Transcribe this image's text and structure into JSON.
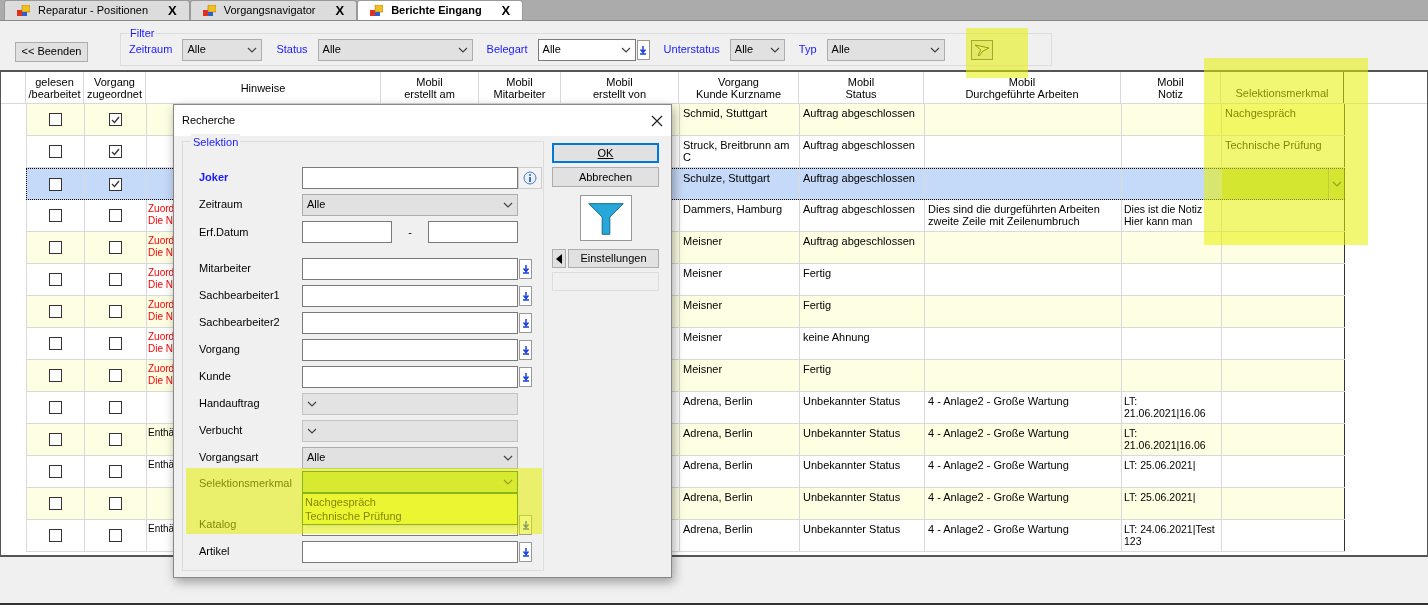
{
  "tabs": [
    {
      "label": "Reparatur - Positionen",
      "selected": false,
      "close": "X"
    },
    {
      "label": "Vorgangsnavigator",
      "selected": false,
      "close": "X"
    },
    {
      "label": "Berichte Eingang",
      "selected": true,
      "close": "X"
    }
  ],
  "toolbar": {
    "exit_button": "<< Beenden",
    "filter": {
      "legend": "Filter",
      "fields": [
        {
          "label": "Zeitraum",
          "value": "Alle",
          "kind": "select"
        },
        {
          "label": "Status",
          "value": "Alle",
          "kind": "select"
        },
        {
          "label": "Belegart",
          "value": "Alle",
          "kind": "combo"
        },
        {
          "label": "Unterstatus",
          "value": "Alle",
          "kind": "select"
        },
        {
          "label": "Typ",
          "value": "Alle",
          "kind": "select"
        }
      ]
    }
  },
  "table": {
    "columns": [
      "",
      "gelesen\n/bearbeitet",
      "Vorgang\nzugeordnet",
      "Hinweise",
      "Mobil\nerstellt am",
      "Mobil\nMitarbeiter",
      "Mobil\nerstellt von",
      "Vorgang\nKunde Kurzname",
      "Mobil\nStatus",
      "Mobil\nDurchgeführte Arbeiten",
      "Mobil\nNotiz",
      "Selektionsmerkmal"
    ],
    "rows": [
      {
        "selected": false,
        "read": false,
        "assigned": true,
        "hinweise": "",
        "kunde": "Schmid, Stuttgart",
        "status": "Auftrag abgeschlossen",
        "arbeiten": "",
        "notiz": "",
        "merkmal": "Nachgespräch"
      },
      {
        "selected": false,
        "read": false,
        "assigned": true,
        "hinweise": "",
        "kunde": "Struck, Breitbrunn am C",
        "status": "Auftrag abgeschlossen",
        "arbeiten": "",
        "notiz": "",
        "merkmal": "Technische Prüfung"
      },
      {
        "selected": true,
        "read": false,
        "assigned": true,
        "hinweise": "",
        "kunde": "Schulze, Stuttgart",
        "status": "Auftrag abgeschlossen",
        "arbeiten": "",
        "notiz": "",
        "merkmal": ""
      },
      {
        "selected": false,
        "read": false,
        "assigned": false,
        "hinweise": "Zuord\nDie N",
        "kunde": "Dammers, Hamburg",
        "status": "Auftrag abgeschlossen",
        "arbeiten": "Dies sind die durgeführten Arbeiten\nzweite Zeile mit Zeilenumbruch",
        "notiz": "Dies ist die Notiz\nHier kann man",
        "merkmal": ""
      },
      {
        "selected": false,
        "read": false,
        "assigned": false,
        "hinweise": "Zuord\nDie N",
        "kunde": "Meisner",
        "status": "Auftrag abgeschlossen",
        "arbeiten": "",
        "notiz": "",
        "merkmal": ""
      },
      {
        "selected": false,
        "read": false,
        "assigned": false,
        "hinweise": "Zuord\nDie N",
        "kunde": "Meisner",
        "status": "Fertig",
        "arbeiten": "",
        "notiz": "",
        "merkmal": ""
      },
      {
        "selected": false,
        "read": false,
        "assigned": false,
        "hinweise": "Zuord\nDie N",
        "kunde": "Meisner",
        "status": "Fertig",
        "arbeiten": "",
        "notiz": "",
        "merkmal": ""
      },
      {
        "selected": false,
        "read": false,
        "assigned": false,
        "hinweise": "Zuord\nDie N",
        "kunde": "Meisner",
        "status": "keine Ahnung",
        "arbeiten": "",
        "notiz": "",
        "merkmal": ""
      },
      {
        "selected": false,
        "read": false,
        "assigned": false,
        "hinweise": "Zuord\nDie N",
        "kunde": "Meisner",
        "status": "Fertig",
        "arbeiten": "",
        "notiz": "",
        "merkmal": ""
      },
      {
        "selected": false,
        "read": false,
        "assigned": false,
        "hinweise": "",
        "kunde": "Adrena, Berlin",
        "status": "Unbekannter Status",
        "arbeiten": "4 - Anlage2 - Große Wartung",
        "notiz": "LT:\n21.06.2021|16.06",
        "merkmal": ""
      },
      {
        "selected": false,
        "read": false,
        "assigned": false,
        "hinweise": "Enthä",
        "kunde": "Adrena, Berlin",
        "status": "Unbekannter Status",
        "arbeiten": "4 - Anlage2 - Große Wartung",
        "notiz": "LT:\n21.06.2021|16.06",
        "merkmal": ""
      },
      {
        "selected": false,
        "read": false,
        "assigned": false,
        "hinweise": "Enthä",
        "kunde": "Adrena, Berlin",
        "status": "Unbekannter Status",
        "arbeiten": "4 - Anlage2 - Große Wartung",
        "notiz": "LT: 25.06.2021|",
        "merkmal": ""
      },
      {
        "selected": false,
        "read": false,
        "assigned": false,
        "hinweise": "",
        "kunde": "Adrena, Berlin",
        "status": "Unbekannter Status",
        "arbeiten": "4 - Anlage2 - Große Wartung",
        "notiz": "LT: 25.06.2021|",
        "merkmal": ""
      },
      {
        "selected": false,
        "read": false,
        "assigned": false,
        "hinweise": "Enthä",
        "kunde": "Adrena, Berlin",
        "status": "Unbekannter Status",
        "arbeiten": "4 - Anlage2 - Große Wartung",
        "notiz": "LT: 24.06.2021|Test\n123",
        "merkmal": ""
      }
    ]
  },
  "dialog": {
    "title": "Recherche",
    "group": "Selektion",
    "fields": [
      {
        "label": "Joker",
        "kind": "joker"
      },
      {
        "label": "Zeitraum",
        "kind": "select",
        "value": "Alle",
        "disabled": false
      },
      {
        "label": "Erf.Datum",
        "kind": "date_range",
        "separator": "-"
      },
      {
        "label": "Mitarbeiter",
        "kind": "lookup"
      },
      {
        "label": "Sachbearbeiter1",
        "kind": "lookup"
      },
      {
        "label": "Sachbearbeiter2",
        "kind": "lookup"
      },
      {
        "label": "Vorgang",
        "kind": "lookup"
      },
      {
        "label": "Kunde",
        "kind": "lookup"
      },
      {
        "label": "Handauftrag",
        "kind": "select",
        "disabled": true
      },
      {
        "label": "Verbucht",
        "kind": "select",
        "disabled": true
      },
      {
        "label": "Vorgangsart",
        "kind": "select",
        "value": "Alle",
        "disabled": false
      },
      {
        "label": "Selektionsmerkmal",
        "kind": "open_select",
        "options": [
          "Nachgespräch",
          "Technische Prüfung"
        ]
      },
      {
        "label": "Katalog",
        "kind": "lookup"
      },
      {
        "label": "Artikel",
        "kind": "lookup"
      }
    ],
    "ok_button": "OK",
    "cancel_button": "Abbrechen",
    "settings_button": "Einstellungen"
  }
}
